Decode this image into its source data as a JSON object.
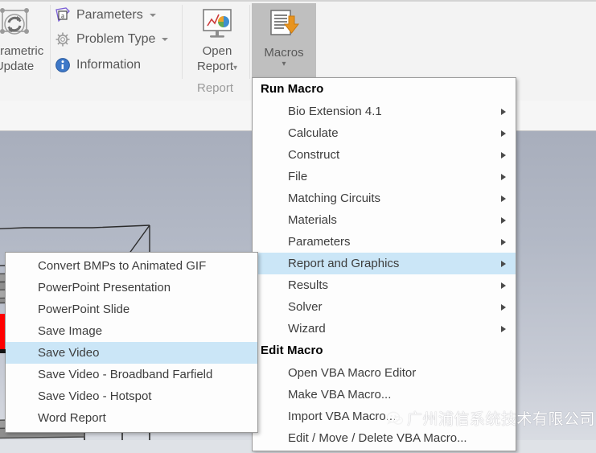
{
  "ribbon": {
    "buttons": {
      "parametric_update": {
        "label_line1": "Parametric",
        "label_line2": "Update",
        "icon": "parametric-update-icon"
      },
      "open_report": {
        "label_line1": "Open",
        "label_line2": "Report",
        "icon": "open-report-icon",
        "has_dropdown": true
      },
      "macros": {
        "label": "Macros",
        "icon": "macros-icon",
        "has_dropdown": true,
        "state": "active"
      }
    },
    "small_buttons": [
      {
        "label": "Parameters",
        "icon": "parameters-icon",
        "has_dropdown": true
      },
      {
        "label": "Problem Type",
        "icon": "problem-type-gear-icon",
        "has_dropdown": true
      },
      {
        "label": "Information",
        "icon": "information-icon",
        "has_dropdown": false
      }
    ],
    "group_labels": {
      "report": "Report"
    }
  },
  "macro_menu": {
    "run_header": "Run Macro",
    "run_items": [
      {
        "label": "Bio Extension 4.1",
        "submenu": true,
        "highlighted": false
      },
      {
        "label": "Calculate",
        "submenu": true,
        "highlighted": false
      },
      {
        "label": "Construct",
        "submenu": true,
        "highlighted": false
      },
      {
        "label": "File",
        "submenu": true,
        "highlighted": false
      },
      {
        "label": "Matching Circuits",
        "submenu": true,
        "highlighted": false
      },
      {
        "label": "Materials",
        "submenu": true,
        "highlighted": false
      },
      {
        "label": "Parameters",
        "submenu": true,
        "highlighted": false
      },
      {
        "label": "Report and Graphics",
        "submenu": true,
        "highlighted": true
      },
      {
        "label": "Results",
        "submenu": true,
        "highlighted": false
      },
      {
        "label": "Solver",
        "submenu": true,
        "highlighted": false
      },
      {
        "label": "Wizard",
        "submenu": true,
        "highlighted": false
      }
    ],
    "edit_header": "Edit Macro",
    "edit_items": [
      {
        "label": "Open VBA Macro Editor",
        "submenu": false,
        "highlighted": false
      },
      {
        "label": "Make VBA Macro...",
        "submenu": false,
        "highlighted": false
      },
      {
        "label": "Import VBA Macro...",
        "submenu": false,
        "highlighted": false
      },
      {
        "label": "Edit / Move / Delete VBA Macro...",
        "submenu": false,
        "highlighted": false
      }
    ]
  },
  "sub_menu": {
    "items": [
      {
        "label": "Convert BMPs to Animated GIF",
        "highlighted": false
      },
      {
        "label": "PowerPoint Presentation",
        "highlighted": false
      },
      {
        "label": "PowerPoint Slide",
        "highlighted": false
      },
      {
        "label": "Save Image",
        "highlighted": false
      },
      {
        "label": "Save Video",
        "highlighted": true
      },
      {
        "label": "Save Video - Broadband Farfield",
        "highlighted": false
      },
      {
        "label": "Save Video - Hotspot",
        "highlighted": false
      },
      {
        "label": "Word Report",
        "highlighted": false
      }
    ]
  },
  "watermark": {
    "text": "广州浦信系统技术有限公司",
    "logo": "wechat-logo-icon"
  },
  "colors": {
    "highlight": "#cbe6f7",
    "ribbon_bg": "#f3f3f3",
    "macros_active_bg": "#bfbfbf",
    "menu_bg": "#fdfdfd",
    "menu_border": "#9a9a9a",
    "viewport_top": "#a8aebc",
    "viewport_bottom": "#dcdfe5",
    "text": "#3d3d3d",
    "marker_red": "#ff0000"
  }
}
